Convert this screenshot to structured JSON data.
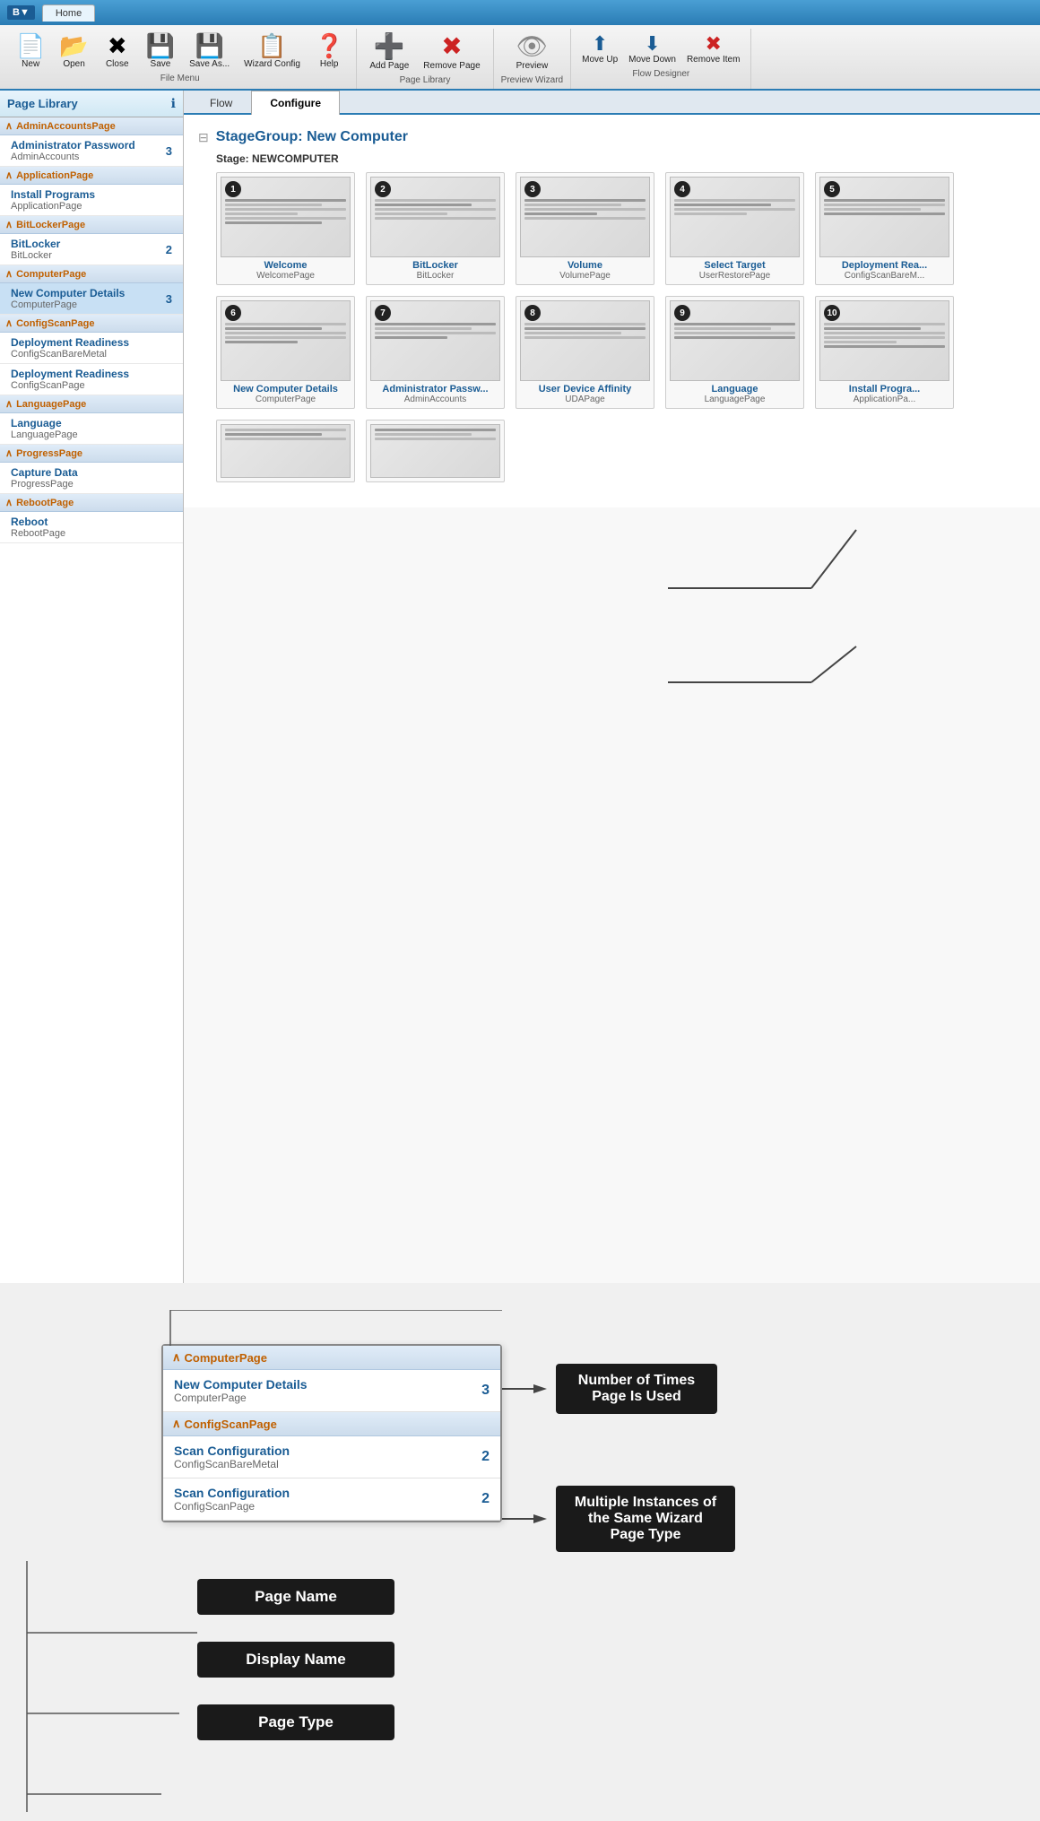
{
  "titleBar": {
    "logo": "B▼",
    "tab": "Home"
  },
  "ribbon": {
    "groups": [
      {
        "label": "File Menu",
        "items": [
          {
            "id": "new",
            "label": "New",
            "icon": "📄"
          },
          {
            "id": "open",
            "label": "Open",
            "icon": "📂"
          },
          {
            "id": "close",
            "label": "Close",
            "icon": "✖"
          },
          {
            "id": "save",
            "label": "Save",
            "icon": "💾"
          },
          {
            "id": "saveas",
            "label": "Save As...",
            "icon": "💾"
          },
          {
            "id": "wizard-config",
            "label": "Wizard Config",
            "icon": "📋"
          },
          {
            "id": "help",
            "label": "Help",
            "icon": "❓"
          }
        ]
      },
      {
        "label": "Page Library",
        "items": [
          {
            "id": "add-page",
            "label": "Add Page",
            "icon": "➕",
            "color": "blue"
          },
          {
            "id": "remove-page",
            "label": "Remove Page",
            "icon": "✖",
            "color": "red"
          }
        ]
      },
      {
        "label": "Preview Wizard",
        "items": [
          {
            "id": "preview",
            "label": "Preview",
            "icon": "👁"
          }
        ]
      },
      {
        "label": "Flow Designer",
        "items": [
          {
            "id": "move-up",
            "label": "Move Up",
            "icon": "⬆"
          },
          {
            "id": "move-down",
            "label": "Move Down",
            "icon": "⬇"
          },
          {
            "id": "remove-item",
            "label": "Remove Item",
            "icon": "✖",
            "color": "red"
          }
        ]
      }
    ]
  },
  "sidebar": {
    "title": "Page Library",
    "categories": [
      {
        "name": "AdminAccountsPage",
        "items": [
          {
            "name": "Administrator Password",
            "type": "AdminAccounts",
            "count": 3,
            "selected": false
          }
        ]
      },
      {
        "name": "ApplicationPage",
        "items": [
          {
            "name": "Install Programs",
            "type": "ApplicationPage",
            "count": null,
            "selected": false
          }
        ]
      },
      {
        "name": "BitLockerPage",
        "items": [
          {
            "name": "BitLocker",
            "type": "BitLocker",
            "count": 2,
            "selected": false
          }
        ]
      },
      {
        "name": "ComputerPage",
        "items": [
          {
            "name": "New Computer Details",
            "type": "ComputerPage",
            "count": 3,
            "selected": true
          }
        ]
      },
      {
        "name": "ConfigScanPage",
        "items": [
          {
            "name": "Deployment Readiness",
            "type": "ConfigScanBareMetal",
            "count": null,
            "selected": false
          },
          {
            "name": "Deployment Readiness",
            "type": "ConfigScanPage",
            "count": null,
            "selected": false
          }
        ]
      },
      {
        "name": "LanguagePage",
        "items": [
          {
            "name": "Language",
            "type": "LanguagePage",
            "count": null,
            "selected": false
          }
        ]
      },
      {
        "name": "ProgressPage",
        "items": [
          {
            "name": "Capture Data",
            "type": "ProgressPage",
            "count": null,
            "selected": false
          }
        ]
      },
      {
        "name": "RebootPage",
        "items": [
          {
            "name": "Reboot",
            "type": "RebootPage",
            "count": null,
            "selected": false
          }
        ]
      }
    ]
  },
  "tabs": [
    {
      "id": "flow",
      "label": "Flow",
      "active": false
    },
    {
      "id": "configure",
      "label": "Configure",
      "active": true
    }
  ],
  "flow": {
    "stageGroup": "StageGroup: New Computer",
    "stage": "Stage: NEWCOMPUTER",
    "pages": [
      {
        "number": 1,
        "title": "Welcome",
        "type": "WelcomePage"
      },
      {
        "number": 2,
        "title": "BitLocker",
        "type": "BitLocker"
      },
      {
        "number": 3,
        "title": "Volume",
        "type": "VolumePage"
      },
      {
        "number": 4,
        "title": "Select Target",
        "type": "UserRestorePage"
      },
      {
        "number": 5,
        "title": "Deployment Rea...",
        "type": "ConfigScanBareM..."
      },
      {
        "number": 6,
        "title": "New Computer Details",
        "type": "ComputerPage"
      },
      {
        "number": 7,
        "title": "Administrator Passw...",
        "type": "AdminAccounts"
      },
      {
        "number": 8,
        "title": "User Device Affinity",
        "type": "UDAPage"
      },
      {
        "number": 9,
        "title": "Language",
        "type": "LanguagePage"
      },
      {
        "number": 10,
        "title": "Install Progra...",
        "type": "ApplicationPa..."
      }
    ]
  },
  "callout": {
    "categories": [
      {
        "name": "ComputerPage",
        "items": [
          {
            "name": "New Computer Details",
            "type": "ComputerPage",
            "count": 3
          }
        ]
      },
      {
        "name": "ConfigScanPage",
        "items": [
          {
            "name": "Scan Configuration",
            "type": "ConfigScanBareMetal",
            "count": 2
          },
          {
            "name": "Scan Configuration",
            "type": "ConfigScanPage",
            "count": 2
          }
        ]
      }
    ]
  },
  "annotations": {
    "numTimesUsed": "Number of Times\nPage Is Used",
    "multipleInstances": "Multiple Instances\nof the Same\nWizard Page Type",
    "pageName": "Page Name",
    "displayName": "Display Name",
    "pageType": "Page Type"
  }
}
